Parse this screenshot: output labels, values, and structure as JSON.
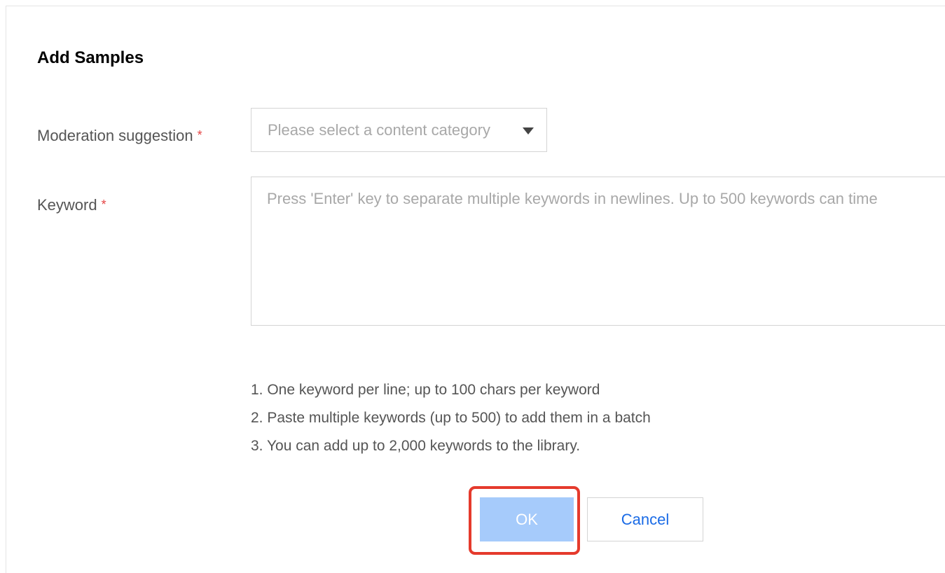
{
  "dialog": {
    "title": "Add Samples"
  },
  "form": {
    "moderation": {
      "label": "Moderation suggestion",
      "required_mark": "*",
      "placeholder": "Please select a content category"
    },
    "keyword": {
      "label": "Keyword",
      "required_mark": "*",
      "placeholder": "Press 'Enter' key to separate multiple keywords in newlines. Up to 500 keywords can time"
    },
    "hints": [
      "1. One keyword per line; up to 100 chars per keyword",
      "2. Paste multiple keywords (up to 500) to add them in a batch",
      "3. You can add up to 2,000 keywords to the library."
    ]
  },
  "actions": {
    "ok_label": "OK",
    "cancel_label": "Cancel"
  },
  "colors": {
    "ok_button_disabled_bg": "#a6cbfb",
    "cancel_text": "#1a6be6",
    "required_star": "#e54545",
    "highlight_border": "#e53a2c"
  },
  "icons": {
    "select_caret": "caret-down-icon"
  }
}
